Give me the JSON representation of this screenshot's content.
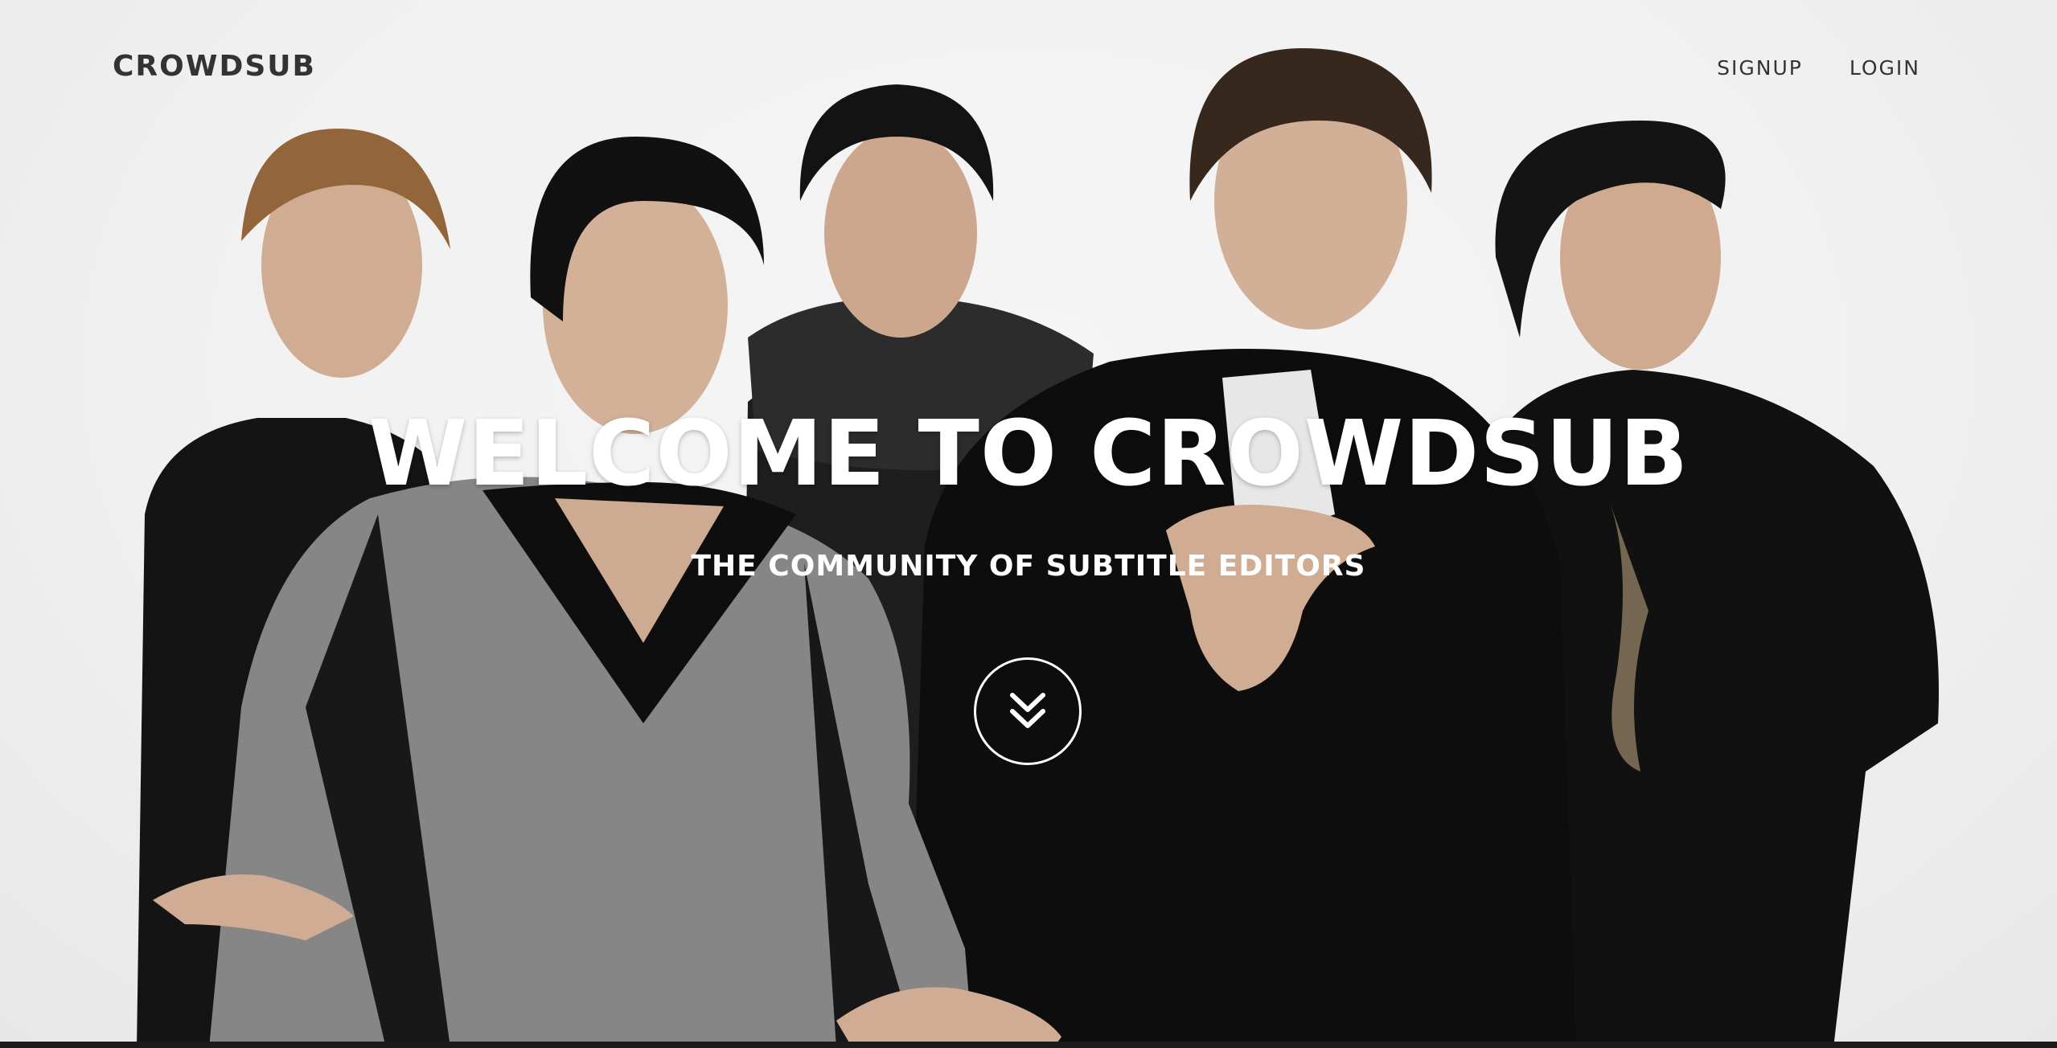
{
  "navbar": {
    "brand": "CROWDSUB",
    "links": [
      {
        "label": "SIGNUP"
      },
      {
        "label": "LOGIN"
      }
    ]
  },
  "hero": {
    "title": "WELCOME TO CROWDSUB",
    "subtitle": "THE COMMUNITY OF SUBTITLE EDITORS",
    "scroll_icon": "double-chevron-down-icon"
  },
  "colors": {
    "nav_text": "#333333",
    "hero_text": "#ffffff",
    "background": "#ffffff"
  }
}
